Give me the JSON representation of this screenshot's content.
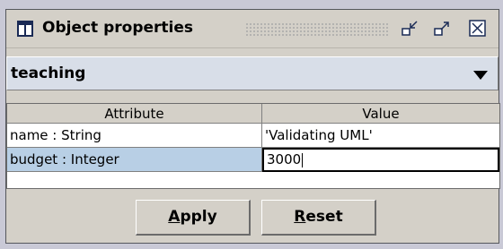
{
  "window": {
    "title": "Object properties",
    "icons": [
      "table-icon",
      "minimize-icon",
      "maximize-icon",
      "close-icon"
    ]
  },
  "object_selector": {
    "selected": "teaching"
  },
  "table": {
    "headers": [
      "Attribute",
      "Value"
    ],
    "rows": [
      {
        "attribute": "name : String",
        "value": "'Validating UML'"
      },
      {
        "attribute": "budget : Integer",
        "value": "3000"
      }
    ]
  },
  "buttons": {
    "apply_mnemonic": "A",
    "apply_rest": "pply",
    "reset_mnemonic": "R",
    "reset_rest": "eset"
  },
  "colors": {
    "selection": "#b8cfe5",
    "combo_bg": "#d8dee8"
  }
}
